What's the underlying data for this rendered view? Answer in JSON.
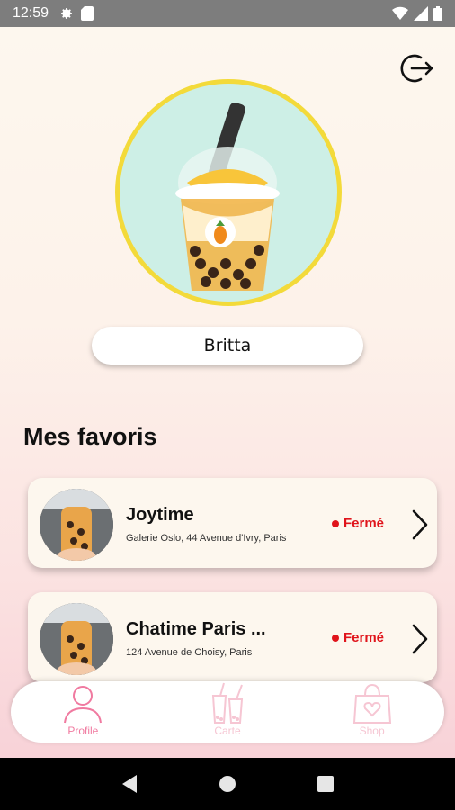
{
  "status_bar": {
    "time": "12:59"
  },
  "profile": {
    "username": "Britta"
  },
  "favorites": {
    "title": "Mes favoris",
    "items": [
      {
        "name": "Joytime",
        "address": "Galerie Oslo, 44 Avenue d'Ivry, Paris",
        "status": "Fermé"
      },
      {
        "name": "Chatime Paris ...",
        "address": "124 Avenue de Choisy, Paris",
        "status": "Fermé"
      }
    ]
  },
  "nav": {
    "profile_label": "Profile",
    "map_label": "Carte",
    "shop_label": "Shop"
  },
  "colors": {
    "accent_pink": "#f07aa0",
    "faded_pink": "#f6c6d3",
    "status_closed": "#e0141b",
    "avatar_border": "#f3da3a",
    "avatar_bg": "#cdefe6"
  }
}
